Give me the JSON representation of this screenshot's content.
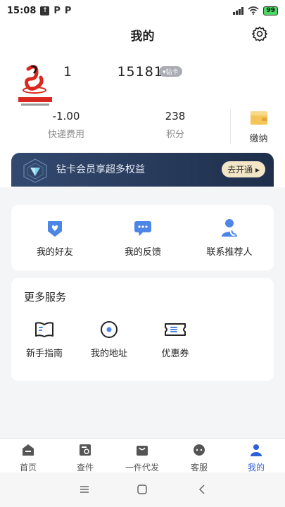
{
  "status_bar": {
    "time": "15:08",
    "battery": "99"
  },
  "header": {
    "title": "我的"
  },
  "profile": {
    "phone": "1         15181",
    "member_tag": "▾钻卡",
    "stats": [
      {
        "value": "-1.00",
        "label": "快递费用"
      },
      {
        "value": "238",
        "label": "积分"
      }
    ],
    "pay_label": "缴纳"
  },
  "vip": {
    "text": "钻卡会员享超多权益",
    "button": "去开通 ▸"
  },
  "quick_actions": [
    {
      "label": "我的好友"
    },
    {
      "label": "我的反馈"
    },
    {
      "label": "联系推荐人"
    }
  ],
  "more_services": {
    "title": "更多服务",
    "items": [
      {
        "label": "新手指南"
      },
      {
        "label": "我的地址"
      },
      {
        "label": "优惠券"
      }
    ]
  },
  "tabbar": [
    {
      "label": "首页"
    },
    {
      "label": "查件"
    },
    {
      "label": "一件代发"
    },
    {
      "label": "客服"
    },
    {
      "label": "我的"
    }
  ],
  "colors": {
    "accent": "#3b6fe0",
    "vip_bg": "#2a3c5d"
  }
}
